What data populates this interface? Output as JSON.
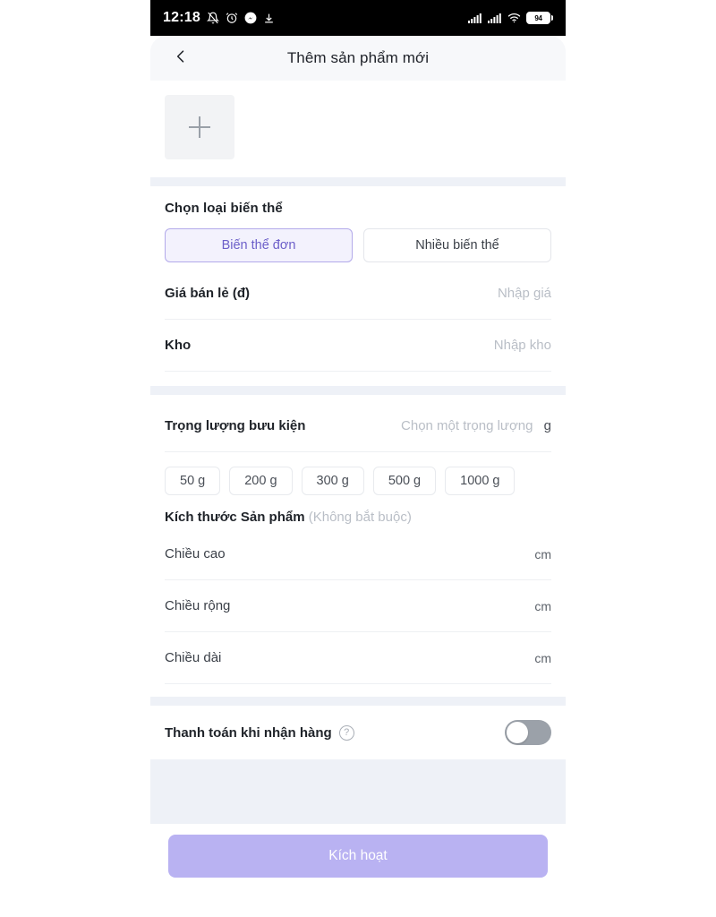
{
  "status_bar": {
    "time": "12:18",
    "icons_left": [
      "mute-bell-icon",
      "alarm-icon",
      "messenger-icon",
      "download-icon"
    ],
    "icons_right": [
      "signal-bars-1-icon",
      "signal-bars-2-icon",
      "wifi-icon"
    ],
    "battery_level": "94"
  },
  "header": {
    "back_icon": "chevron-left-icon",
    "title": "Thêm sản phẩm mới"
  },
  "photo": {
    "add_icon": "plus-icon"
  },
  "variant": {
    "section_label": "Chọn loại biến thể",
    "options": [
      {
        "label": "Biến thể đơn",
        "selected": true
      },
      {
        "label": "Nhiều biến thể",
        "selected": false
      }
    ],
    "price": {
      "label": "Giá bán lẻ (đ)",
      "placeholder": "Nhập giá",
      "value": ""
    },
    "stock": {
      "label": "Kho",
      "placeholder": "Nhập kho",
      "value": ""
    }
  },
  "shipping": {
    "weight": {
      "label": "Trọng lượng bưu kiện",
      "placeholder": "Chọn một trọng lượng",
      "unit": "g",
      "value": ""
    },
    "weight_chips": [
      "50 g",
      "200 g",
      "300 g",
      "500 g",
      "1000 g"
    ],
    "dimensions_title": "Kích thước Sản phẩm",
    "dimensions_optional": "(Không bắt buộc)",
    "fields": [
      {
        "label": "Chiều cao",
        "unit": "cm",
        "value": ""
      },
      {
        "label": "Chiều rộng",
        "unit": "cm",
        "value": ""
      },
      {
        "label": "Chiều dài",
        "unit": "cm",
        "value": ""
      }
    ]
  },
  "cod": {
    "label": "Thanh toán khi nhận hàng",
    "help_icon": "question-circle-icon",
    "enabled": false
  },
  "footer": {
    "cta_label": "Kích hoạt"
  },
  "colors": {
    "accent": "#6c5fc9",
    "cta": "#b9b2f2",
    "surface": "#ffffff",
    "page_bg": "#eef1f7"
  }
}
